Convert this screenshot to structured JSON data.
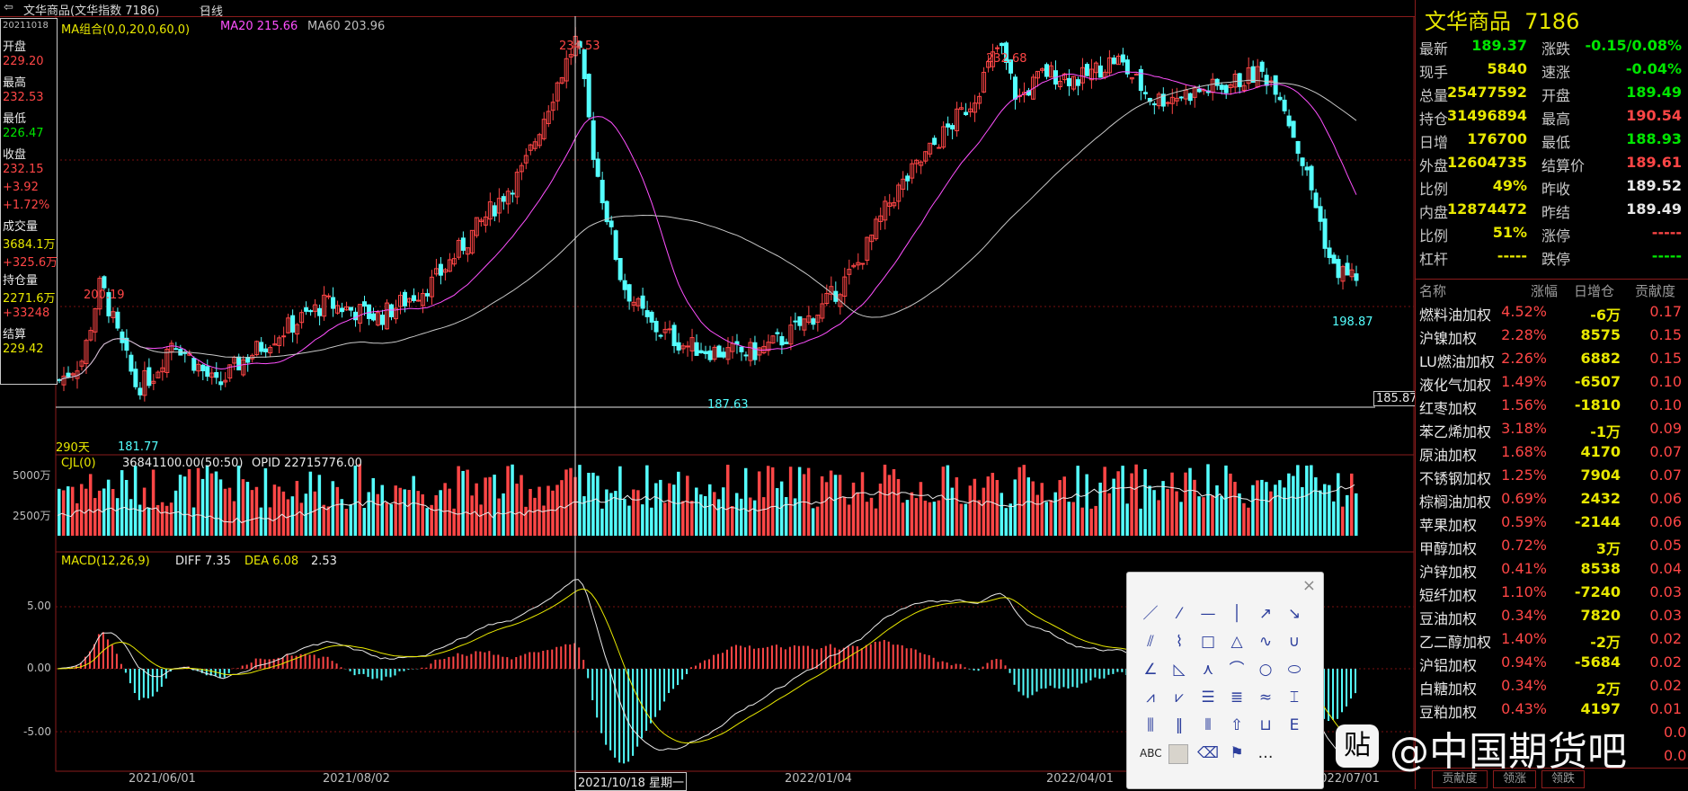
{
  "titlebar": {
    "menu_icon": "menu-arrows-icon",
    "title": "文华商品(文华指数 7186)",
    "period": "日线"
  },
  "infobox": {
    "date": "20211018",
    "open_label": "开盘",
    "open": "229.20",
    "high_label": "最高",
    "high": "232.53",
    "low_label": "最低",
    "low": "226.47",
    "close_label": "收盘",
    "close": "232.15",
    "change": "+3.92",
    "change_pct": "+1.72%",
    "volume_label": "成交量",
    "volume": "3684.1万",
    "volume_change": "+325.6万",
    "oi_label": "持仓量",
    "oi": "2271.6万",
    "oi_change": "+33248",
    "settle_label": "结算",
    "settle": "229.42"
  },
  "main_chart": {
    "ma_label": "MA组合(0,0,20,0,60,0)",
    "ma20_label": "MA20 215.66",
    "ma60_label": "MA60 203.96",
    "peak_label": "234.53",
    "peak2_label": "232.68",
    "left_peak_label": "200.19",
    "low1_label": "181.77",
    "low2_label": "187.63",
    "last_low_label": "198.87",
    "crosshair_price": "185.87",
    "days_label": "290天",
    "colors": {
      "up": "#ff4646",
      "down": "#54ffff",
      "ma20": "#ff50ff",
      "ma60": "#c8c8c8"
    }
  },
  "volume_panel": {
    "label": "CJL(0)",
    "values_text": "36841100.00(50:50)",
    "opid_text": "OPID 22715776.00",
    "tick_5000": "5000万",
    "tick_2500": "2500万"
  },
  "macd_panel": {
    "label": "MACD(12,26,9)",
    "diff": "DIFF 7.35",
    "dea": "DEA 6.08",
    "macd": "2.53",
    "tick_5": "5.00",
    "tick_0": "0.00",
    "tick_m5": "-5.00"
  },
  "xaxis": {
    "labels": [
      "2021/06/01",
      "2021/08/02",
      "2022/01/04",
      "2022/04/01",
      "2022/07/01"
    ],
    "cursor_label": "2021/10/18 星期一"
  },
  "quote": {
    "name": "文华商品",
    "code": "7186",
    "rows": [
      {
        "l1": "最新",
        "v1": "189.37",
        "c1": "green",
        "l2": "涨跌",
        "v2": "-0.15/0.08%",
        "c2": "green"
      },
      {
        "l1": "现手",
        "v1": "5840",
        "c1": "yel",
        "l2": "速涨",
        "v2": "-0.04%",
        "c2": "green"
      },
      {
        "l1": "总量",
        "v1": "25477592",
        "c1": "yel",
        "l2": "开盘",
        "v2": "189.49",
        "c2": "green"
      },
      {
        "l1": "持仓",
        "v1": "31496894",
        "c1": "yel",
        "l2": "最高",
        "v2": "190.54",
        "c2": "red"
      },
      {
        "l1": "日增",
        "v1": "176700",
        "c1": "yel",
        "l2": "最低",
        "v2": "188.93",
        "c2": "green"
      },
      {
        "l1": "外盘",
        "v1": "12604735",
        "c1": "yel",
        "l2": "结算价",
        "v2": "189.61",
        "c2": "red"
      },
      {
        "l1": "比例",
        "v1": "49%",
        "c1": "yel",
        "l2": "昨收",
        "v2": "189.52",
        "c2": "wht"
      },
      {
        "l1": "内盘",
        "v1": "12874472",
        "c1": "yel",
        "l2": "昨结",
        "v2": "189.49",
        "c2": "wht"
      },
      {
        "l1": "比例",
        "v1": "51%",
        "c1": "yel",
        "l2": "涨停",
        "v2": "-----",
        "c2": "red"
      },
      {
        "l1": "杠杆",
        "v1": "-----",
        "c1": "yel",
        "l2": "跌停",
        "v2": "-----",
        "c2": "green"
      }
    ]
  },
  "contrib_list": {
    "headers": [
      "名称",
      "涨幅",
      "日增仓",
      "贡献度"
    ],
    "rows": [
      {
        "name": "燃料油加权",
        "pct": "4.52%",
        "oi": "-6万",
        "contrib": "0.17"
      },
      {
        "name": "沪镍加权",
        "pct": "2.28%",
        "oi": "8575",
        "contrib": "0.15"
      },
      {
        "name": "LU燃油加权",
        "pct": "2.26%",
        "oi": "6882",
        "contrib": "0.15"
      },
      {
        "name": "液化气加权",
        "pct": "1.49%",
        "oi": "-6507",
        "contrib": "0.10"
      },
      {
        "name": "红枣加权",
        "pct": "1.56%",
        "oi": "-1810",
        "contrib": "0.10"
      },
      {
        "name": "苯乙烯加权",
        "pct": "3.18%",
        "oi": "-1万",
        "contrib": "0.09"
      },
      {
        "name": "原油加权",
        "pct": "1.68%",
        "oi": "4170",
        "contrib": "0.07"
      },
      {
        "name": "不锈钢加权",
        "pct": "1.25%",
        "oi": "7904",
        "contrib": "0.07"
      },
      {
        "name": "棕榈油加权",
        "pct": "0.69%",
        "oi": "2432",
        "contrib": "0.06"
      },
      {
        "name": "苹果加权",
        "pct": "0.59%",
        "oi": "-2144",
        "contrib": "0.06"
      },
      {
        "name": "甲醇加权",
        "pct": "0.72%",
        "oi": "3万",
        "contrib": "0.05"
      },
      {
        "name": "沪锌加权",
        "pct": "0.41%",
        "oi": "8538",
        "contrib": "0.04"
      },
      {
        "name": "短纤加权",
        "pct": "1.10%",
        "oi": "-7240",
        "contrib": "0.03"
      },
      {
        "name": "豆油加权",
        "pct": "0.34%",
        "oi": "7820",
        "contrib": "0.03"
      },
      {
        "name": "乙二醇加权",
        "pct": "1.40%",
        "oi": "-2万",
        "contrib": "0.02"
      },
      {
        "name": "沪铝加权",
        "pct": "0.94%",
        "oi": "-5684",
        "contrib": "0.02"
      },
      {
        "name": "白糖加权",
        "pct": "0.34%",
        "oi": "2万",
        "contrib": "0.02"
      },
      {
        "name": "豆粕加权",
        "pct": "0.43%",
        "oi": "4197",
        "contrib": "0.01"
      }
    ],
    "extra_contrib": [
      "0.01",
      "0.01",
      "0.0"
    ],
    "tabs": [
      "贡献度",
      "领涨",
      "领跌"
    ]
  },
  "palette": {
    "close": "×",
    "tools": [
      "line-tool-icon",
      "ray-tool-icon",
      "hline-tool-icon",
      "vline-tool-icon",
      "arrow-line-tool-icon",
      "arrow-down-tool-icon",
      "parallel-tool-icon",
      "polyline-tool-icon",
      "rect-tool-icon",
      "triangle-tool-icon",
      "wave-tool-icon",
      "u-shape-tool-icon",
      "gann-tool-icon",
      "angle-tool-icon",
      "fork-tool-icon",
      "arc-tool-icon",
      "circle-tool-icon",
      "ellipse-tool-icon",
      "fan-tool-icon",
      "speed-line-tool-icon",
      "channel-tool-icon",
      "fib-tool-icon",
      "resistance-tool-icon",
      "fib-retrace-tool-icon",
      "cycle-tool-icon",
      "time-zone-tool-icon",
      "period-tool-icon",
      "up-arrow-tool-icon",
      "ruler-tool-icon",
      "text-e-tool-icon",
      "text-tool-icon",
      "color-tool-icon",
      "eraser-tool-icon",
      "flag-tool-icon",
      "more-tool-icon"
    ],
    "text_label": "ABC",
    "more_label": "…"
  },
  "watermark": {
    "icon": "贴",
    "text": "@中国期货吧"
  }
}
